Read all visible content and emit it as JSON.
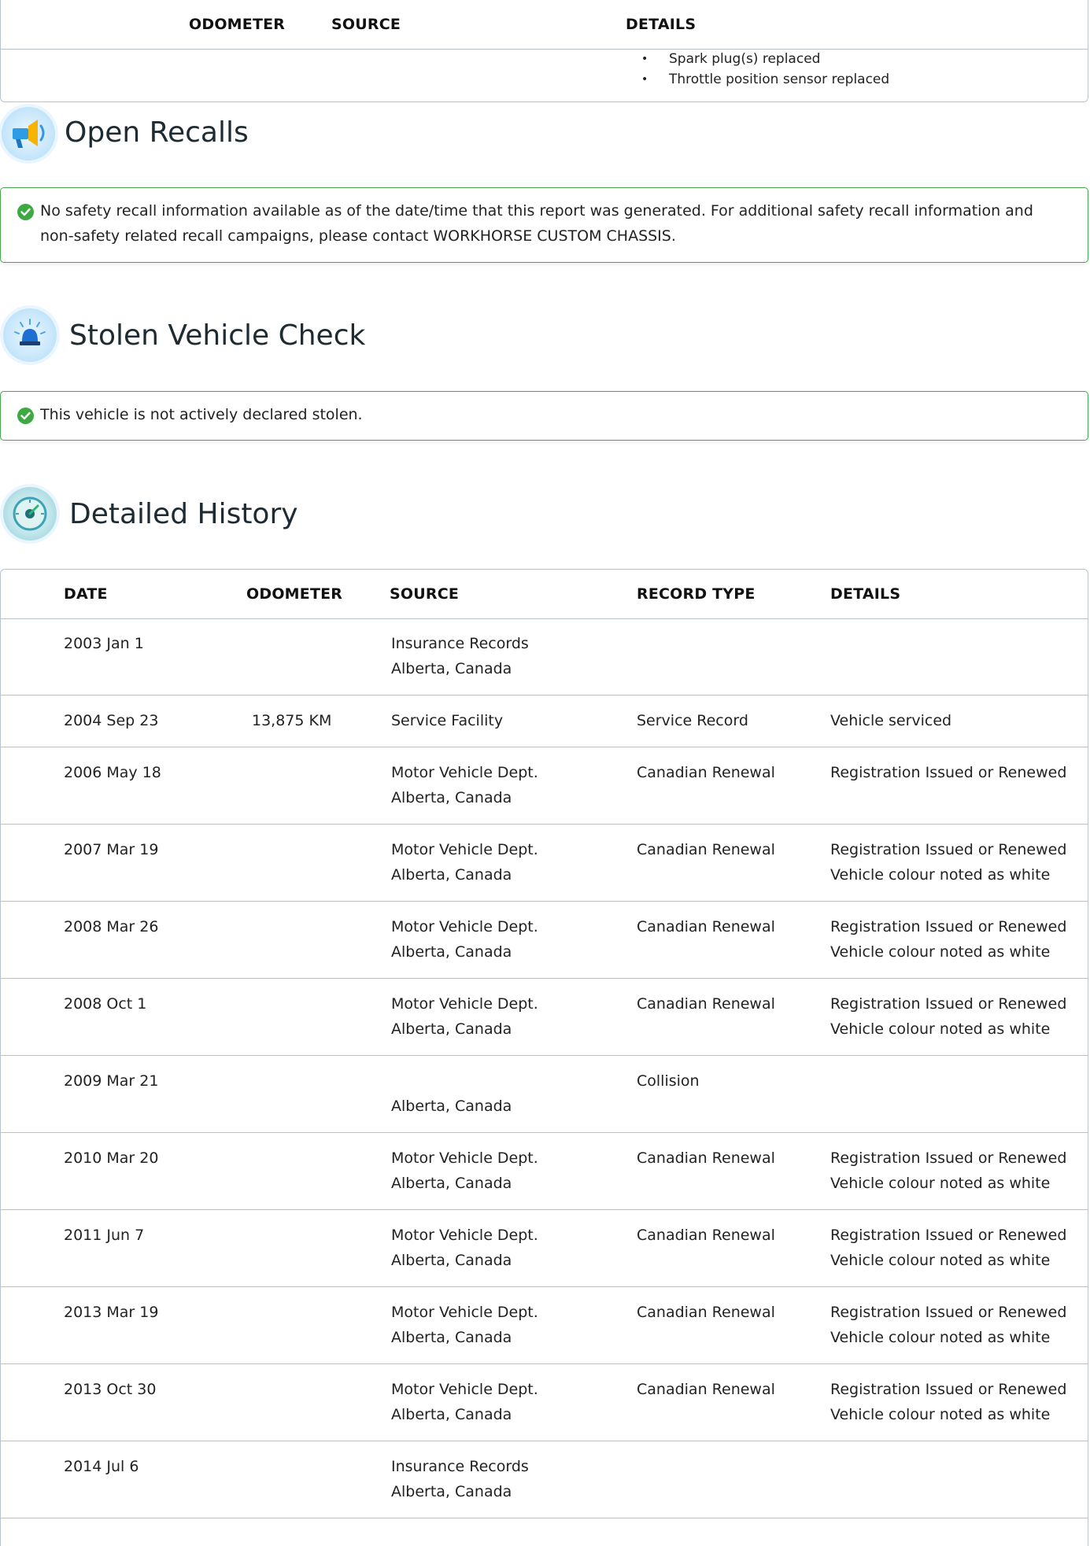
{
  "top_table": {
    "headers": {
      "odometer": "ODOMETER",
      "source": "SOURCE",
      "details": "DETAILS"
    },
    "details": [
      "Spark plug(s) replaced",
      "Throttle position sensor replaced"
    ]
  },
  "recalls": {
    "title": "Open Recalls",
    "icon": "megaphone-icon",
    "message": "No safety recall information available as of the date/time that this report was generated. For additional safety recall information and non-safety related recall campaigns, please contact WORKHORSE CUSTOM CHASSIS."
  },
  "stolen": {
    "title": "Stolen Vehicle Check",
    "icon": "siren-icon",
    "message": "This vehicle is not actively declared stolen."
  },
  "history": {
    "title": "Detailed History",
    "icon": "odometer-dial-icon",
    "headers": {
      "date": "DATE",
      "odometer": "ODOMETER",
      "source": "SOURCE",
      "record_type": "RECORD TYPE",
      "details": "DETAILS"
    },
    "rows": [
      {
        "date": "2003 Jan 1",
        "odometer": "",
        "source": [
          "Insurance Records",
          "Alberta, Canada"
        ],
        "record_type": "",
        "details": []
      },
      {
        "date": "2004 Sep 23",
        "odometer": "13,875 KM",
        "source": [
          "Service Facility"
        ],
        "record_type": "Service Record",
        "details": [
          "Vehicle serviced"
        ]
      },
      {
        "date": "2006 May 18",
        "odometer": "",
        "source": [
          "Motor Vehicle Dept.",
          "Alberta, Canada"
        ],
        "record_type": "Canadian Renewal",
        "details": [
          "Registration Issued or Renewed"
        ]
      },
      {
        "date": "2007 Mar 19",
        "odometer": "",
        "source": [
          "Motor Vehicle Dept.",
          "Alberta, Canada"
        ],
        "record_type": "Canadian Renewal",
        "details": [
          "Registration Issued or Renewed",
          "Vehicle colour noted as white"
        ]
      },
      {
        "date": "2008 Mar 26",
        "odometer": "",
        "source": [
          "Motor Vehicle Dept.",
          "Alberta, Canada"
        ],
        "record_type": "Canadian Renewal",
        "details": [
          "Registration Issued or Renewed",
          "Vehicle colour noted as white"
        ]
      },
      {
        "date": "2008 Oct 1",
        "odometer": "",
        "source": [
          "Motor Vehicle Dept.",
          "Alberta, Canada"
        ],
        "record_type": "Canadian Renewal",
        "details": [
          "Registration Issued or Renewed",
          "Vehicle colour noted as white"
        ]
      },
      {
        "date": "2009 Mar 21",
        "odometer": "",
        "source": [
          "",
          "Alberta, Canada"
        ],
        "record_type": "Collision",
        "details": []
      },
      {
        "date": "2010 Mar 20",
        "odometer": "",
        "source": [
          "Motor Vehicle Dept.",
          "Alberta, Canada"
        ],
        "record_type": "Canadian Renewal",
        "details": [
          "Registration Issued or Renewed",
          "Vehicle colour noted as white"
        ]
      },
      {
        "date": "2011 Jun 7",
        "odometer": "",
        "source": [
          "Motor Vehicle Dept.",
          "Alberta, Canada"
        ],
        "record_type": "Canadian Renewal",
        "details": [
          "Registration Issued or Renewed",
          "Vehicle colour noted as white"
        ]
      },
      {
        "date": "2013 Mar 19",
        "odometer": "",
        "source": [
          "Motor Vehicle Dept.",
          "Alberta, Canada"
        ],
        "record_type": "Canadian Renewal",
        "details": [
          "Registration Issued or Renewed",
          "Vehicle colour noted as white"
        ]
      },
      {
        "date": "2013 Oct 30",
        "odometer": "",
        "source": [
          "Motor Vehicle Dept.",
          "Alberta, Canada"
        ],
        "record_type": "Canadian Renewal",
        "details": [
          "Registration Issued or Renewed",
          "Vehicle colour noted as white"
        ]
      },
      {
        "date": "2014 Jul 6",
        "odometer": "",
        "source": [
          "Insurance Records",
          "Alberta, Canada"
        ],
        "record_type": "",
        "details": []
      }
    ]
  },
  "colors": {
    "success_green": "#3ea943",
    "border_gray": "#b9c3cf",
    "icon_blue": "#c9e7fb"
  }
}
